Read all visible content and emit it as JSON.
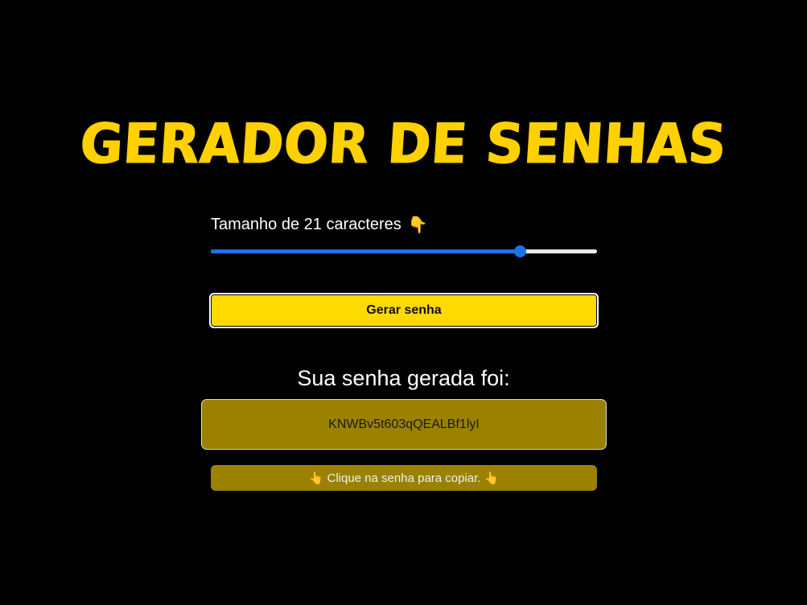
{
  "title": "GERADOR DE SENHAS",
  "length": {
    "label": "Tamanho de 21 caracteres",
    "icon": "pointing-down-hand-icon",
    "icon_glyph": "👇",
    "slider_fraction": 0.8,
    "accent_color": "#1a73e8"
  },
  "generate_button": {
    "label": "Gerar senha",
    "color": "#FFDA00"
  },
  "result": {
    "heading": "Sua senha gerada foi:",
    "password": "KNWBv5t603qQEALBf1lyI",
    "box_color": "#9A8100"
  },
  "copy_hint": {
    "icon": "pointing-up-hand-icon",
    "icon_glyph": "👆",
    "text": "Clique na senha para copiar."
  },
  "colors": {
    "background": "#000000",
    "brand_yellow": "#FFD100"
  }
}
